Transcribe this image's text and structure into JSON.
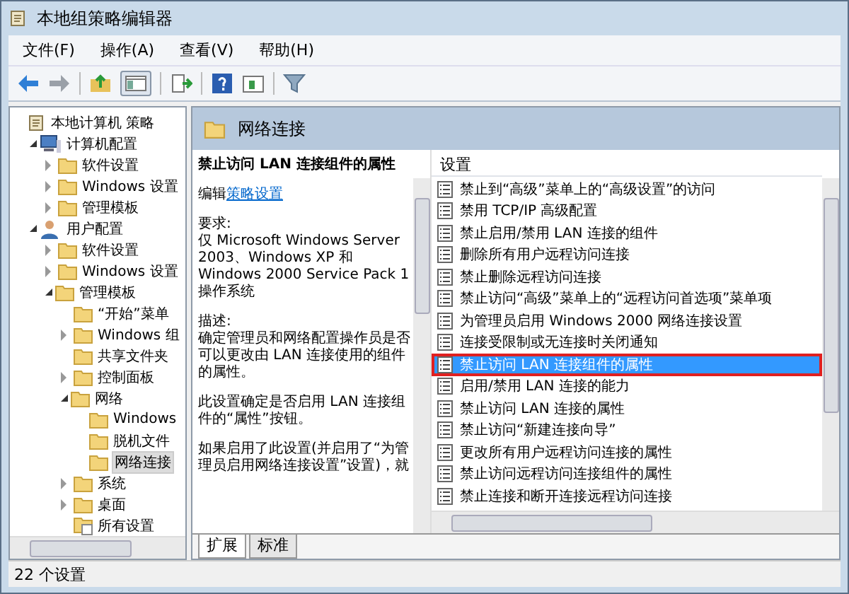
{
  "window": {
    "title": "本地组策略编辑器"
  },
  "menu": [
    "文件(F)",
    "操作(A)",
    "查看(V)",
    "帮助(H)"
  ],
  "tree": [
    {
      "label": "本地计算机 策略",
      "kind": "policy",
      "children": [
        {
          "label": "计算机配置",
          "kind": "computer",
          "expanded": true,
          "children": [
            {
              "label": "软件设置",
              "kind": "folder",
              "expanded": false
            },
            {
              "label": "Windows 设置",
              "kind": "folder",
              "expanded": false
            },
            {
              "label": "管理模板",
              "kind": "folder",
              "expanded": false
            }
          ]
        },
        {
          "label": "用户配置",
          "kind": "user",
          "expanded": true,
          "children": [
            {
              "label": "软件设置",
              "kind": "folder",
              "expanded": false
            },
            {
              "label": "Windows 设置",
              "kind": "folder",
              "expanded": false
            },
            {
              "label": "管理模板",
              "kind": "folder",
              "expanded": true,
              "children": [
                {
                  "label": "“开始”菜单",
                  "kind": "folder"
                },
                {
                  "label": "Windows 组",
                  "kind": "folder",
                  "expanded": false
                },
                {
                  "label": "共享文件夹",
                  "kind": "folder"
                },
                {
                  "label": "控制面板",
                  "kind": "folder",
                  "expanded": false
                },
                {
                  "label": "网络",
                  "kind": "folder",
                  "expanded": true,
                  "children": [
                    {
                      "label": "Windows",
                      "kind": "folder"
                    },
                    {
                      "label": "脱机文件",
                      "kind": "folder"
                    },
                    {
                      "label": "网络连接",
                      "kind": "folder",
                      "selected": true
                    }
                  ]
                },
                {
                  "label": "系统",
                  "kind": "folder",
                  "expanded": false
                },
                {
                  "label": "桌面",
                  "kind": "folder",
                  "expanded": false
                },
                {
                  "label": "所有设置",
                  "kind": "settings"
                }
              ]
            }
          ]
        }
      ]
    }
  ],
  "content": {
    "heading": "网络连接",
    "description": {
      "title": "禁止访问 LAN 连接组件的属性",
      "edit_prefix": "编辑",
      "edit_link": "策略设置",
      "paragraphs": [
        "要求:\n仅 Microsoft Windows Server 2003、Windows XP 和 Windows 2000 Service Pack 1 操作系统",
        "描述:\n确定管理员和网络配置操作员是否可以更改由 LAN 连接使用的组件的属性。",
        "此设置确定是否启用 LAN 连接组件的“属性”按钮。",
        "如果启用了此设置(并启用了“为管理员启用网络连接设置”设置)，就"
      ]
    },
    "list_header": "设置",
    "settings": [
      {
        "label": "禁止到“高级”菜单上的“高级设置”的访问",
        "selected": false
      },
      {
        "label": "禁用 TCP/IP 高级配置",
        "selected": false
      },
      {
        "label": "禁止启用/禁用 LAN 连接的组件",
        "selected": false
      },
      {
        "label": "删除所有用户远程访问连接",
        "selected": false
      },
      {
        "label": "禁止删除远程访问连接",
        "selected": false
      },
      {
        "label": "禁止访问“高级”菜单上的“远程访问首选项”菜单项",
        "selected": false
      },
      {
        "label": "为管理员启用 Windows 2000 网络连接设置",
        "selected": false
      },
      {
        "label": "连接受限制或无连接时关闭通知",
        "selected": false
      },
      {
        "label": "禁止访问 LAN 连接组件的属性",
        "selected": true
      },
      {
        "label": "启用/禁用 LAN 连接的能力",
        "selected": false
      },
      {
        "label": "禁止访问 LAN 连接的属性",
        "selected": false
      },
      {
        "label": "禁止访问“新建连接向导”",
        "selected": false
      },
      {
        "label": "更改所有用户远程访问连接的属性",
        "selected": false
      },
      {
        "label": "禁止访问远程访问连接组件的属性",
        "selected": false
      },
      {
        "label": "禁止连接和断开连接远程访问连接",
        "selected": false
      }
    ],
    "tabs": [
      {
        "label": "扩展",
        "selected": true
      },
      {
        "label": "标准",
        "selected": false
      }
    ]
  },
  "status_bar": "22 个设置"
}
